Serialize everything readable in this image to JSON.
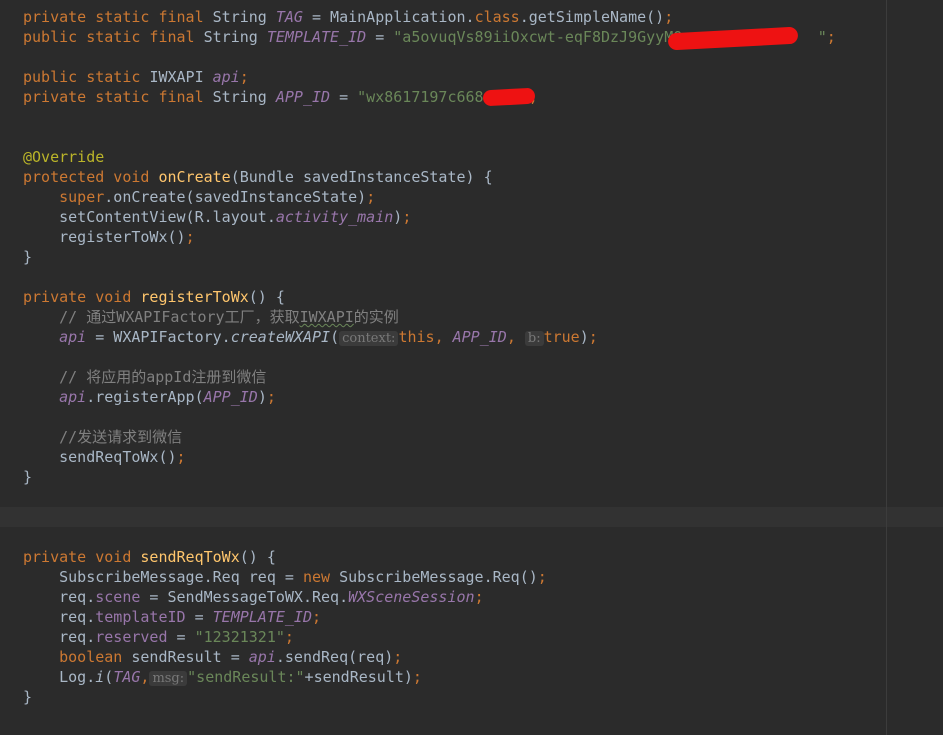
{
  "lines": [
    [
      {
        "t": "private static final ",
        "c": "kw"
      },
      {
        "t": "String ",
        "c": "type"
      },
      {
        "t": "TAG",
        "c": "const"
      },
      {
        "t": " = MainApplication.",
        "c": "plain"
      },
      {
        "t": "class",
        "c": "kw"
      },
      {
        "t": ".getSimpleName()",
        "c": "plain"
      },
      {
        "t": ";",
        "c": "kw"
      }
    ],
    [
      {
        "t": "public static final ",
        "c": "kw"
      },
      {
        "t": "String ",
        "c": "type"
      },
      {
        "t": "TEMPLATE_ID",
        "c": "const"
      },
      {
        "t": " = ",
        "c": "plain"
      },
      {
        "t": "\"a5ovuqVs89iiOxcwt-eqF8DzJ9GyyMQ",
        "c": "str"
      },
      {
        "t": "               ",
        "c": "str"
      },
      {
        "t": "\"",
        "c": "str"
      },
      {
        "t": ";",
        "c": "kw"
      }
    ],
    [],
    [
      {
        "t": "public static ",
        "c": "kw"
      },
      {
        "t": "IWXAPI ",
        "c": "type"
      },
      {
        "t": "api",
        "c": "const"
      },
      {
        "t": ";",
        "c": "kw"
      }
    ],
    [
      {
        "t": "private static final ",
        "c": "kw"
      },
      {
        "t": "String ",
        "c": "type"
      },
      {
        "t": "APP_ID",
        "c": "const"
      },
      {
        "t": " = ",
        "c": "plain"
      },
      {
        "t": "\"wx8617197c668",
        "c": "str"
      },
      {
        "t": "    \"",
        "c": "str"
      },
      {
        "t": ";",
        "c": "kw"
      }
    ],
    [],
    [],
    [
      {
        "t": "@Override",
        "c": "anno"
      }
    ],
    [
      {
        "t": "protected void ",
        "c": "kw"
      },
      {
        "t": "onCreate",
        "c": "method"
      },
      {
        "t": "(Bundle savedInstanceState) {",
        "c": "plain"
      }
    ],
    [
      {
        "t": "    ",
        "c": "plain"
      },
      {
        "t": "super",
        "c": "kw"
      },
      {
        "t": ".onCreate(savedInstanceState)",
        "c": "plain"
      },
      {
        "t": ";",
        "c": "kw"
      }
    ],
    [
      {
        "t": "    setContentView(R.layout.",
        "c": "plain"
      },
      {
        "t": "activity_main",
        "c": "const"
      },
      {
        "t": ")",
        "c": "plain"
      },
      {
        "t": ";",
        "c": "kw"
      }
    ],
    [
      {
        "t": "    registerToWx()",
        "c": "plain"
      },
      {
        "t": ";",
        "c": "kw"
      }
    ],
    [
      {
        "t": "}",
        "c": "plain"
      }
    ],
    [],
    [
      {
        "t": "private void ",
        "c": "kw"
      },
      {
        "t": "registerToWx",
        "c": "method"
      },
      {
        "t": "() {",
        "c": "plain"
      }
    ],
    [
      {
        "t": "    // 通过WXAPIFactory工厂，获取",
        "c": "comment"
      },
      {
        "t": "IWXAPI",
        "c": "comment typo"
      },
      {
        "t": "的实例",
        "c": "comment"
      }
    ],
    [
      {
        "t": "    ",
        "c": "plain"
      },
      {
        "t": "api",
        "c": "const"
      },
      {
        "t": " = WXAPIFactory.",
        "c": "plain"
      },
      {
        "t": "createWXAPI",
        "c": "static-call"
      },
      {
        "t": "(",
        "c": "plain"
      },
      {
        "t": "context:",
        "c": "hint"
      },
      {
        "t": "this",
        "c": "kw"
      },
      {
        "t": ", ",
        "c": "kw"
      },
      {
        "t": "APP_ID",
        "c": "const"
      },
      {
        "t": ", ",
        "c": "kw"
      },
      {
        "t": "b:",
        "c": "hint"
      },
      {
        "t": "true",
        "c": "kw"
      },
      {
        "t": ")",
        "c": "plain"
      },
      {
        "t": ";",
        "c": "kw"
      }
    ],
    [],
    [
      {
        "t": "    // 将应用的appId注册到微信",
        "c": "comment"
      }
    ],
    [
      {
        "t": "    ",
        "c": "plain"
      },
      {
        "t": "api",
        "c": "const"
      },
      {
        "t": ".registerApp(",
        "c": "plain"
      },
      {
        "t": "APP_ID",
        "c": "const"
      },
      {
        "t": ")",
        "c": "plain"
      },
      {
        "t": ";",
        "c": "kw"
      }
    ],
    [],
    [
      {
        "t": "    //发送请求到微信",
        "c": "comment"
      }
    ],
    [
      {
        "t": "    sendReqToWx()",
        "c": "plain"
      },
      {
        "t": ";",
        "c": "kw"
      }
    ],
    [
      {
        "t": "}",
        "c": "plain"
      }
    ],
    [],
    [],
    [],
    [
      {
        "t": "private void ",
        "c": "kw"
      },
      {
        "t": "sendReqToWx",
        "c": "method"
      },
      {
        "t": "() {",
        "c": "plain"
      }
    ],
    [
      {
        "t": "    SubscribeMessage.Req req = ",
        "c": "plain"
      },
      {
        "t": "new ",
        "c": "kw"
      },
      {
        "t": "SubscribeMessage.Req()",
        "c": "plain"
      },
      {
        "t": ";",
        "c": "kw"
      }
    ],
    [
      {
        "t": "    req.",
        "c": "plain"
      },
      {
        "t": "scene",
        "c": "field"
      },
      {
        "t": " = SendMessageToWX.Req.",
        "c": "plain"
      },
      {
        "t": "WXSceneSession",
        "c": "const"
      },
      {
        "t": ";",
        "c": "kw"
      }
    ],
    [
      {
        "t": "    req.",
        "c": "plain"
      },
      {
        "t": "templateID",
        "c": "field"
      },
      {
        "t": " = ",
        "c": "plain"
      },
      {
        "t": "TEMPLATE_ID",
        "c": "const"
      },
      {
        "t": ";",
        "c": "kw"
      }
    ],
    [
      {
        "t": "    req.",
        "c": "plain"
      },
      {
        "t": "reserved",
        "c": "field"
      },
      {
        "t": " = ",
        "c": "plain"
      },
      {
        "t": "\"12321321\"",
        "c": "str"
      },
      {
        "t": ";",
        "c": "kw"
      }
    ],
    [
      {
        "t": "    ",
        "c": "plain"
      },
      {
        "t": "boolean ",
        "c": "kw"
      },
      {
        "t": "sendResult = ",
        "c": "plain"
      },
      {
        "t": "api",
        "c": "const"
      },
      {
        "t": ".sendReq(req)",
        "c": "plain"
      },
      {
        "t": ";",
        "c": "kw"
      }
    ],
    [
      {
        "t": "    Log.",
        "c": "plain"
      },
      {
        "t": "i",
        "c": "static-call"
      },
      {
        "t": "(",
        "c": "plain"
      },
      {
        "t": "TAG",
        "c": "const"
      },
      {
        "t": ",",
        "c": "kw"
      },
      {
        "t": "msg:",
        "c": "hint"
      },
      {
        "t": "\"sendResult:\"",
        "c": "str"
      },
      {
        "t": "+sendResult)",
        "c": "plain"
      },
      {
        "t": ";",
        "c": "kw"
      }
    ],
    [
      {
        "t": "}",
        "c": "plain"
      }
    ]
  ]
}
